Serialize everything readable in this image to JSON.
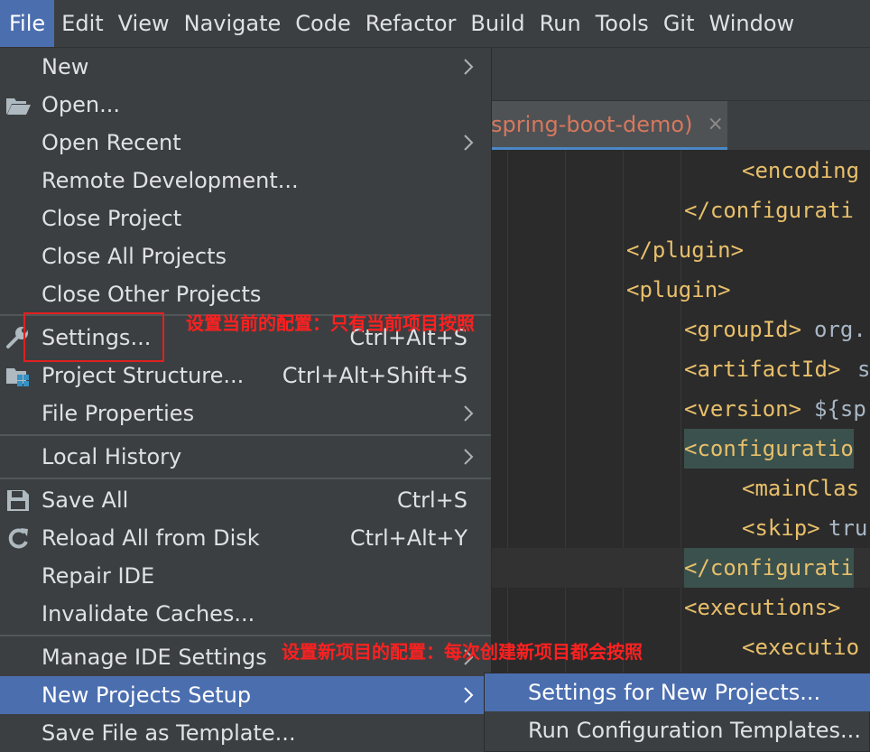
{
  "menubar": {
    "items": [
      {
        "label": "File",
        "active": true
      },
      {
        "label": "Edit"
      },
      {
        "label": "View"
      },
      {
        "label": "Navigate"
      },
      {
        "label": "Code"
      },
      {
        "label": "Refactor"
      },
      {
        "label": "Build"
      },
      {
        "label": "Run"
      },
      {
        "label": "Tools"
      },
      {
        "label": "Git"
      },
      {
        "label": "Window"
      }
    ]
  },
  "editor_tab": {
    "label": "spring-boot-demo)",
    "close": "×"
  },
  "code": {
    "lines": [
      "<encoding",
      "</configurati",
      "</plugin>",
      "<plugin>",
      "<groupId>",
      "org.",
      "<artifactId>",
      "s",
      "<version>",
      "${sp",
      "<configuratio",
      "<mainClas",
      "<skip>",
      "tru",
      "</configurati",
      "<executions>",
      "<executio"
    ]
  },
  "file_menu": {
    "items": [
      {
        "label": "New",
        "submenu": true
      },
      {
        "label": "Open...",
        "icon": "folder-open-icon"
      },
      {
        "label": "Open Recent",
        "submenu": true
      },
      {
        "label": "Remote Development..."
      },
      {
        "label": "Close Project"
      },
      {
        "label": "Close All Projects"
      },
      {
        "label": "Close Other Projects"
      },
      {
        "label": "Settings...",
        "shortcut": "Ctrl+Alt+S",
        "icon": "wrench-icon"
      },
      {
        "label": "Project Structure...",
        "shortcut": "Ctrl+Alt+Shift+S",
        "icon": "project-structure-icon"
      },
      {
        "label": "File Properties",
        "submenu": true
      },
      {
        "label": "Local History",
        "submenu": true
      },
      {
        "label": "Save All",
        "shortcut": "Ctrl+S",
        "icon": "save-icon"
      },
      {
        "label": "Reload All from Disk",
        "shortcut": "Ctrl+Alt+Y",
        "icon": "reload-icon"
      },
      {
        "label": "Repair IDE"
      },
      {
        "label": "Invalidate Caches..."
      },
      {
        "label": "Manage IDE Settings",
        "submenu": true
      },
      {
        "label": "New Projects Setup",
        "submenu": true,
        "selected": true
      },
      {
        "label": "Save File as Template..."
      }
    ]
  },
  "submenu": {
    "items": [
      {
        "label": "Settings for New Projects...",
        "selected": true
      },
      {
        "label": "Run Configuration Templates..."
      }
    ]
  },
  "annotations": {
    "settings_note": "设置当前的配置：只有当前项目按照",
    "new_projects_note": "设置新项目的配置：每次创建新项目都会按照"
  },
  "colors": {
    "menu_bg": "#3c3f41",
    "selection": "#4b6eaf",
    "editor_bg": "#2b2b2b",
    "xml_tag": "#e8bf6a",
    "text": "#a9b7c6",
    "annotation": "#ff2020"
  }
}
